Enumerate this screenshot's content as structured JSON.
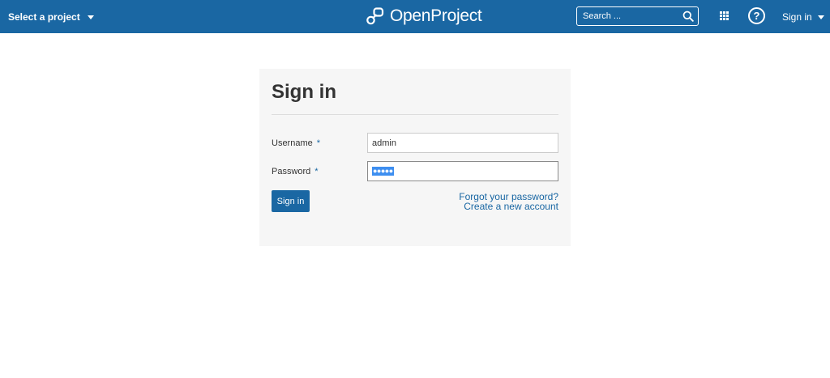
{
  "header": {
    "project_select_label": "Select a project",
    "logo_text": "OpenProject",
    "search_placeholder": "Search ...",
    "help_glyph": "?",
    "signin_menu_label": "Sign in",
    "background_color": "#1a67a3",
    "icons": [
      "chevron-down-icon",
      "openproject-logo-icon",
      "search-icon",
      "modules-grid-icon",
      "help-icon"
    ]
  },
  "login": {
    "title": "Sign in",
    "username_label": "Username",
    "username_value": "admin",
    "password_label": "Password",
    "password_mask": "●●●●●",
    "required_marker": "*",
    "submit_label": "Sign in",
    "forgot_password_link": "Forgot your password?",
    "create_account_link": "Create a new account",
    "accent_color": "#1a67a3"
  }
}
